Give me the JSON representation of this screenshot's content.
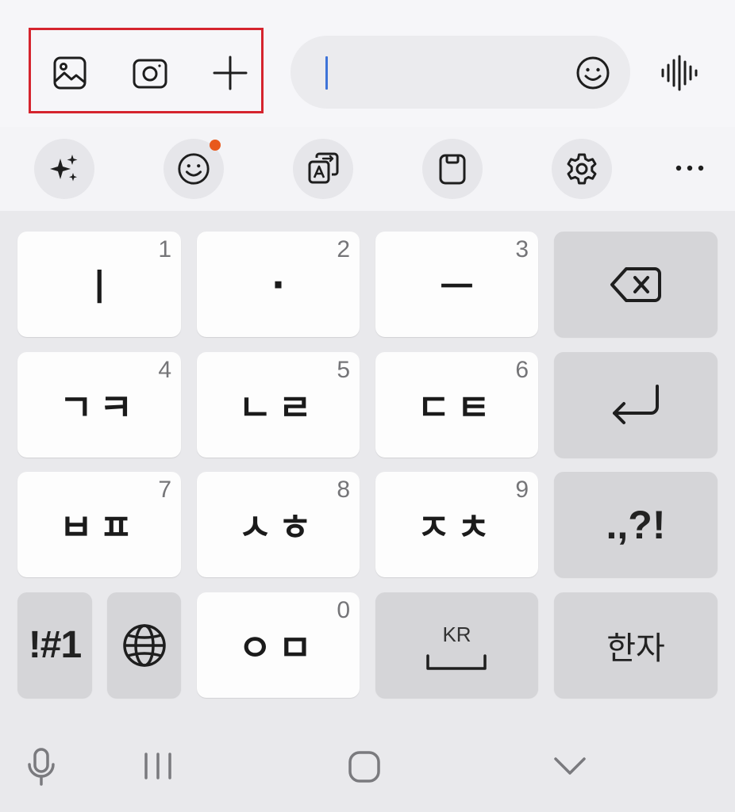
{
  "input_bar": {
    "icons": [
      "gallery-icon",
      "camera-icon",
      "plus-icon"
    ],
    "input_value": "",
    "emoji_icon": "emoji-icon",
    "voice_icon": "voice-wave-icon"
  },
  "toolbar": {
    "items": [
      "ai-sparkle-icon",
      "emoji-icon",
      "translate-icon",
      "clipboard-icon",
      "settings-icon",
      "more-icon"
    ],
    "notification_color": "#e8591c"
  },
  "keyboard": {
    "rows": [
      [
        {
          "main": "ㅣ",
          "hint": "1"
        },
        {
          "main": "·",
          "hint": "2"
        },
        {
          "main": "ㅡ",
          "hint": "3"
        },
        {
          "icon": "backspace-icon"
        }
      ],
      [
        {
          "main": "ㄱㅋ",
          "hint": "4"
        },
        {
          "main": "ㄴㄹ",
          "hint": "5"
        },
        {
          "main": "ㄷㅌ",
          "hint": "6"
        },
        {
          "icon": "enter-icon"
        }
      ],
      [
        {
          "main": "ㅂㅍ",
          "hint": "7"
        },
        {
          "main": "ㅅㅎ",
          "hint": "8"
        },
        {
          "main": "ㅈㅊ",
          "hint": "9"
        },
        {
          "main": ".,?!"
        }
      ]
    ],
    "bottom_row": {
      "symbols": "!#1",
      "globe": "globe-icon",
      "zero_key": {
        "main": "ㅇㅁ",
        "hint": "0"
      },
      "space": {
        "label": "KR"
      },
      "hanja": "한자"
    }
  },
  "navbar": {
    "items": [
      "mic-icon",
      "recent-apps-icon",
      "home-icon",
      "collapse-keyboard-icon"
    ]
  },
  "colors": {
    "highlight": "#d5242e",
    "caret": "#3e73d8"
  }
}
